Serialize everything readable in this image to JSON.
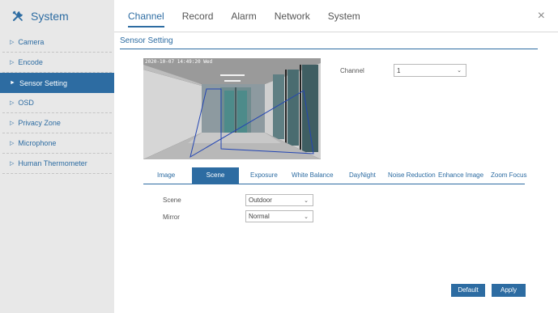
{
  "brand": {
    "title": "System",
    "icon": "wrench-icon"
  },
  "tabs": [
    "Channel",
    "Record",
    "Alarm",
    "Network",
    "System"
  ],
  "close_label": "×",
  "sidebar": {
    "items": [
      {
        "label": "Camera"
      },
      {
        "label": "Encode"
      },
      {
        "label": "Sensor Setting"
      },
      {
        "label": "OSD"
      },
      {
        "label": "Privacy Zone"
      },
      {
        "label": "Microphone"
      },
      {
        "label": "Human Thermometer"
      }
    ],
    "arrow_closed": "▷",
    "arrow_active": "►"
  },
  "section": {
    "title": "Sensor Setting"
  },
  "preview": {
    "osd": "2020-10-07 14:49:20 Wed"
  },
  "channel": {
    "label": "Channel",
    "value": "1"
  },
  "subtabs": [
    "Image",
    "Scene",
    "Exposure",
    "White Balance",
    "DayNight",
    "Noise Reduction",
    "Enhance Image",
    "Zoom Focus"
  ],
  "fields": {
    "scene": {
      "label": "Scene",
      "value": "Outdoor"
    },
    "mirror": {
      "label": "Mirror",
      "value": "Normal"
    }
  },
  "buttons": {
    "default": "Default",
    "apply": "Apply"
  },
  "colors": {
    "accent": "#2d6ca2",
    "sidebar_bg": "#e8e8e8"
  }
}
